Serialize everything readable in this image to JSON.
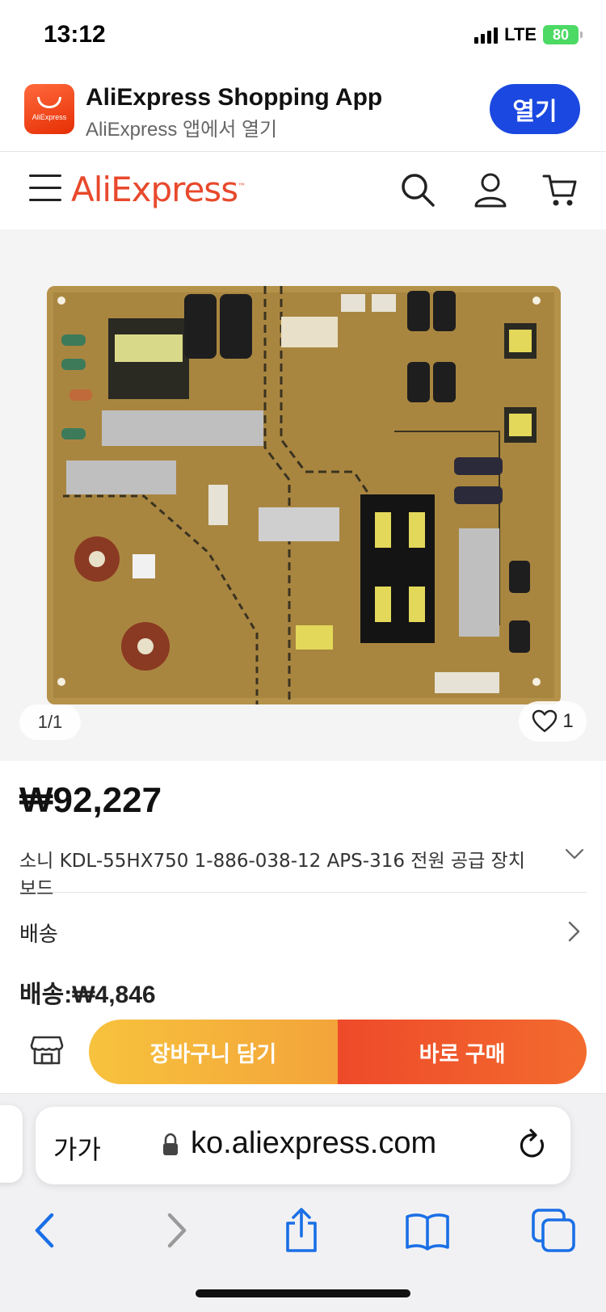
{
  "status_bar": {
    "time": "13:12",
    "network": "LTE",
    "battery": "80"
  },
  "app_banner": {
    "title": "AliExpress Shopping App",
    "subtitle": "AliExpress 앱에서 열기",
    "open_label": "열기",
    "logo_text": "AliExpress"
  },
  "header": {
    "brand": "AliExpress",
    "brand_tm": "™"
  },
  "gallery": {
    "counter": "1/1",
    "wishlist_count": "1"
  },
  "product": {
    "price": "₩92,227",
    "title": "소니 KDL-55HX750 1-886-038-12 APS-316 전원 공급 장치 보드",
    "shipping_label": "배송",
    "shipping_fee": "배송:₩4,846"
  },
  "actions": {
    "add_to_cart": "장바구니 담기",
    "buy_now": "바로 구매"
  },
  "safari": {
    "text_size": "가가",
    "url": "ko.aliexpress.com"
  },
  "colors": {
    "brand": "#e8492c",
    "open_button": "#1a48e0",
    "cart_button": "#f5b33b",
    "buy_button": "#ee4a2a",
    "safari_blue": "#1a6fe6"
  }
}
